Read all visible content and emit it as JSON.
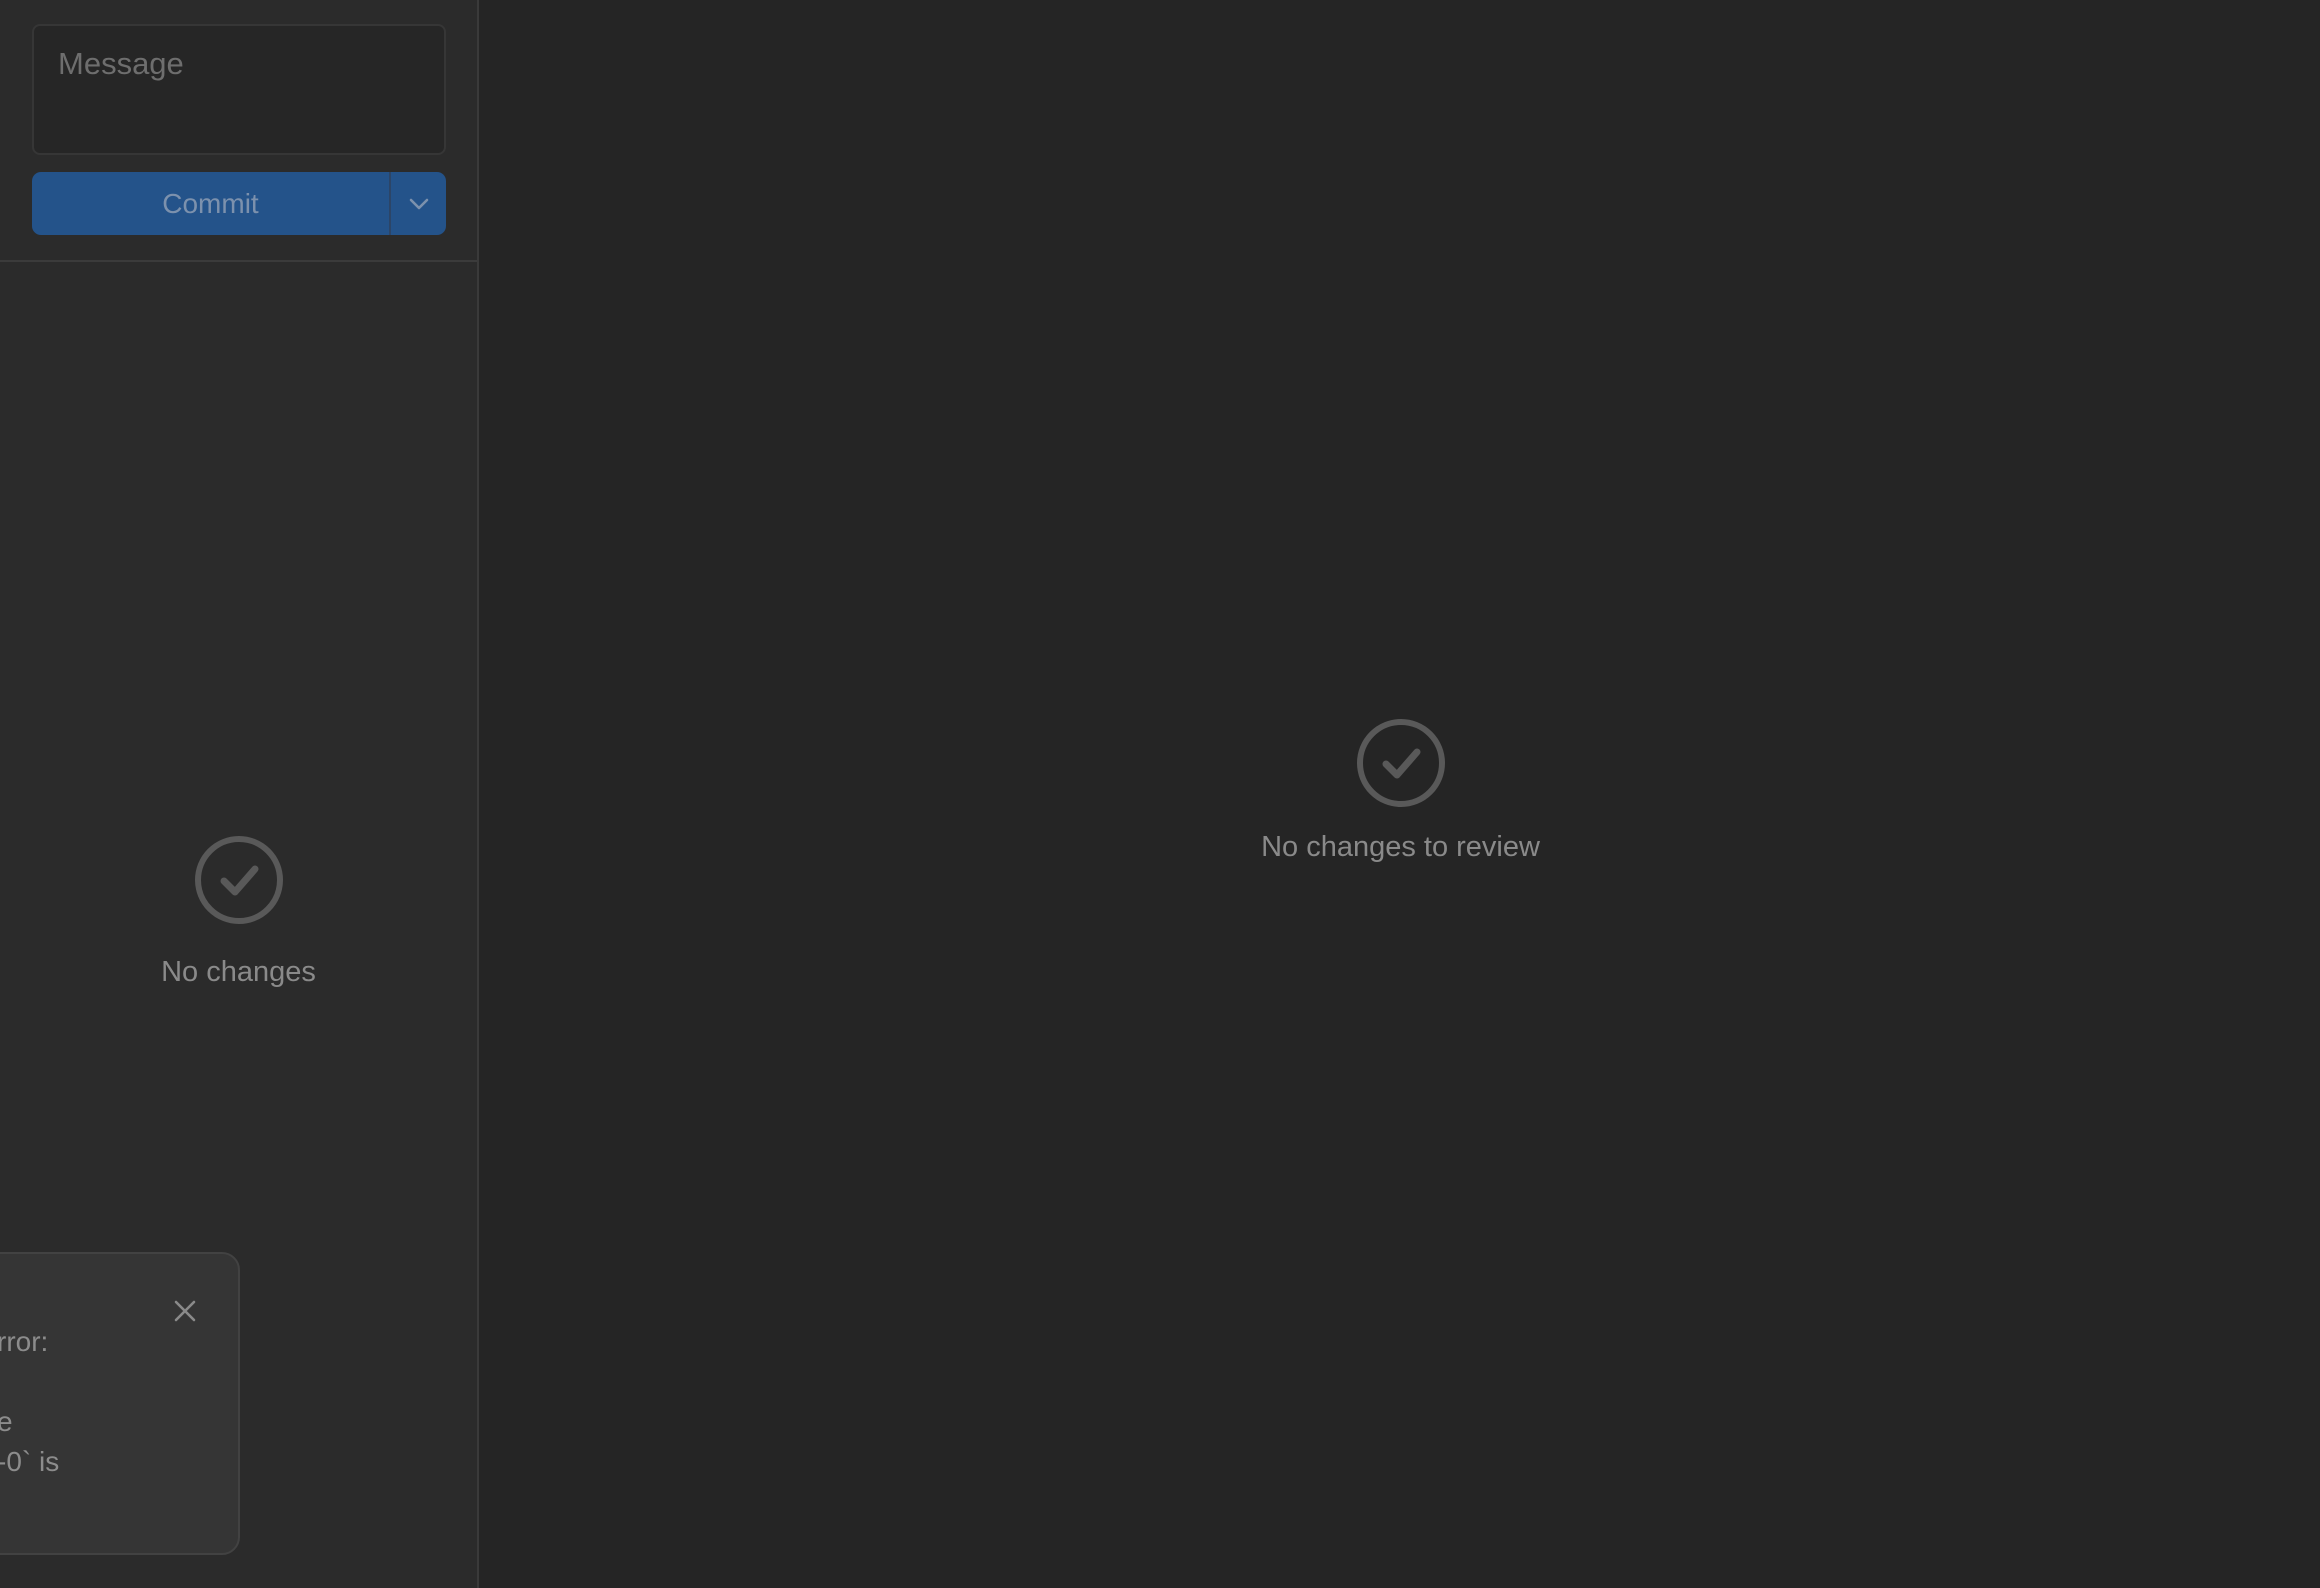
{
  "commit_panel": {
    "message_placeholder": "Message",
    "message_value": "",
    "commit_label": "Commit",
    "dropdown_icon": "chevron-down-icon"
  },
  "changes_list": {
    "empty_icon": "check-circle-icon",
    "empty_text": "No changes"
  },
  "review_panel": {
    "empty_icon": "check-circle-icon",
    "empty_text": "No changes to review"
  },
  "toast": {
    "close_icon": "close-icon",
    "lines": [
      "rror:",
      "",
      "e",
      "-0` is"
    ]
  },
  "colors": {
    "background": "#252525",
    "sidebar": "#2b2b2b",
    "accent": "#24538a",
    "toast": "#353535"
  }
}
